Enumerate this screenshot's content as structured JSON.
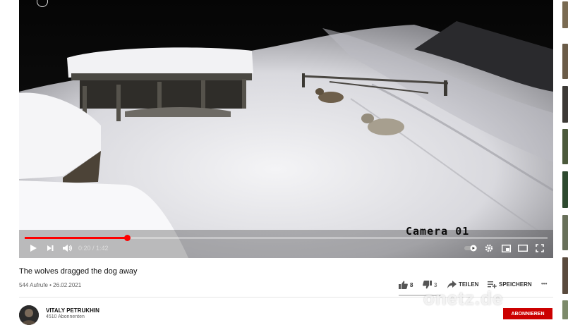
{
  "video": {
    "overlay_text": "Camera 01",
    "current_time": "0:20",
    "time_separator": " / ",
    "duration": "1:42",
    "progress_fraction": 0.196
  },
  "info": {
    "title": "The wolves dragged the dog away",
    "views_date": "544 Aufrufe • 26.02.2021",
    "likes": "8",
    "dislikes": "3",
    "share_label": "TEILEN",
    "save_label": "SPEICHERN",
    "more_label": "•••"
  },
  "channel": {
    "name": "VITALY PETRUKHIN",
    "subscribers": "4510 Abonnenten",
    "subscribe_label": "ABONNIEREN"
  },
  "watermark": "onetz.de",
  "colors": {
    "accent": "#ff0000",
    "subscribe": "#cc0000"
  }
}
